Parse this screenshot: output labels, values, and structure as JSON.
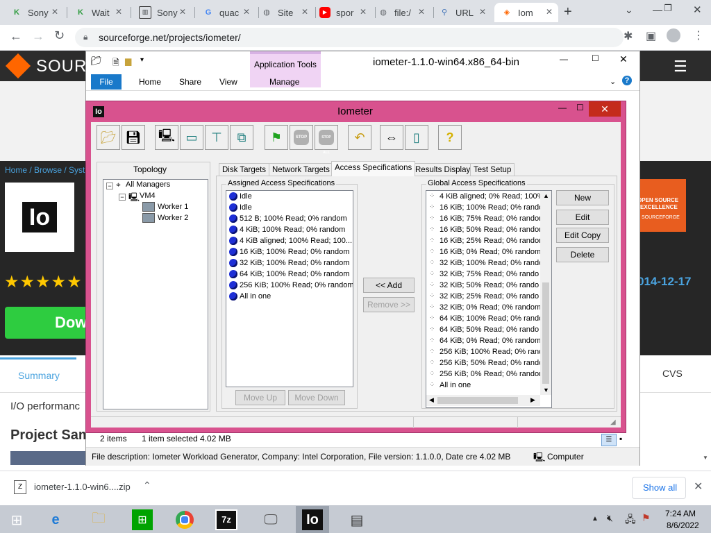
{
  "browser": {
    "tabs": [
      {
        "label": "Sony",
        "icon": "k-icon",
        "active": false
      },
      {
        "label": "Wait",
        "icon": "k-icon",
        "active": false
      },
      {
        "label": "Sony",
        "icon": "museum-icon",
        "active": false
      },
      {
        "label": "quac",
        "icon": "google-icon",
        "active": false
      },
      {
        "label": "Site",
        "icon": "globe-icon",
        "active": false
      },
      {
        "label": "spor",
        "icon": "youtube-icon",
        "active": false
      },
      {
        "label": "file:/",
        "icon": "globe-icon",
        "active": false
      },
      {
        "label": "URL",
        "icon": "link-icon",
        "active": false
      },
      {
        "label": "Iom",
        "icon": "sourceforge-icon",
        "active": true
      }
    ],
    "url": "sourceforge.net/projects/iometer/"
  },
  "webpage": {
    "logo_text": "SOURC",
    "breadcrumb": "Home / Browse / Syste",
    "download_label": "Dow",
    "date": "014-12-17",
    "tab_summary": "Summary",
    "tab_cvs": "CVS",
    "desc": "I/O performanc",
    "project_samples": "Project Sam",
    "badge_line1": "OPEN SOURCE",
    "badge_line2": "EXCELLENCE",
    "badge_brand": "SOURCEFORGE"
  },
  "explorer": {
    "title": "iometer-1.1.0-win64.x86_64-bin",
    "context_tab": "Application Tools",
    "ribbon_tabs": [
      "File",
      "Home",
      "Share",
      "View"
    ],
    "manage": "Manage",
    "status_items": "2 items",
    "status_selected": "1 item selected  4.02 MB",
    "details": "File description: Iometer Workload Generator, Company: Intel Corporation, File version: 1.1.0.0, Date cre 4.02 MB",
    "computer": "Computer"
  },
  "iometer": {
    "title": "Iometer",
    "logo": "Io",
    "topology_label": "Topology",
    "tree": [
      "All Managers",
      "VM4",
      "Worker 1",
      "Worker 2"
    ],
    "tabs": [
      "Disk Targets",
      "Network Targets",
      "Access Specifications",
      "Results Display",
      "Test Setup"
    ],
    "assigned_label": "Assigned Access Specifications",
    "assigned": [
      "Idle",
      "Idle",
      "512 B; 100% Read; 0% random",
      "4 KiB; 100% Read; 0% random",
      "4 KiB aligned; 100% Read; 100...",
      "16 KiB; 100% Read; 0% random",
      "32 KiB; 100% Read; 0% random",
      "64 KiB; 100% Read; 0% random",
      "256 KiB; 100% Read; 0% random",
      "All in one"
    ],
    "global_label": "Global Access Specifications",
    "global": [
      "4 KiB aligned; 0% Read; 100%",
      "16 KiB; 100% Read; 0% rando",
      "16 KiB; 75% Read; 0% random",
      "16 KiB; 50% Read; 0% random",
      "16 KiB; 25% Read; 0% random",
      "16 KiB; 0% Read; 0% random",
      "32 KiB; 100% Read; 0% rando",
      "32 KiB; 75% Read; 0% rando",
      "32 KiB; 50% Read; 0% rando",
      "32 KiB; 25% Read; 0% rando",
      "32 KiB; 0% Read; 0% random",
      "64 KiB; 100% Read; 0% rando",
      "64 KiB; 50% Read; 0% rando",
      "64 KiB; 0% Read; 0% random",
      "256 KiB; 100% Read; 0% rand",
      "256 KiB; 50% Read; 0% rando",
      "256 KiB; 0% Read; 0% random",
      "All in one"
    ],
    "add": "<< Add",
    "remove": "Remove >>",
    "move_up": "Move Up",
    "move_down": "Move Down",
    "new": "New",
    "edit": "Edit",
    "edit_copy": "Edit Copy",
    "delete": "Delete",
    "tb_stop": "STOP",
    "tb_stop_all": "STOP ALL"
  },
  "download_bar": {
    "file": "iometer-1.1.0-win6....zip",
    "show_all": "Show all"
  },
  "taskbar": {
    "time": "7:24 AM",
    "date": "8/6/2022",
    "io_label": "Io",
    "zip_label": "7z"
  }
}
